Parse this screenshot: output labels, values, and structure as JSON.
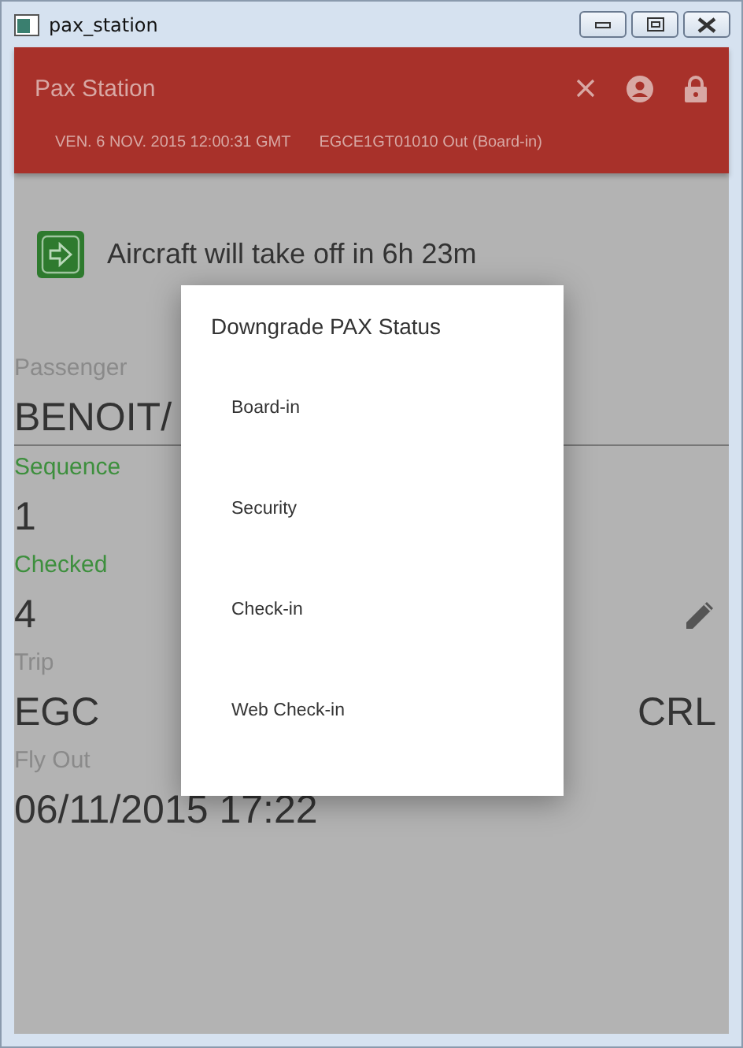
{
  "window": {
    "title": "pax_station"
  },
  "app_bar": {
    "title": "Pax Station",
    "date": "VEN. 6 NOV. 2015 12:00:31 GMT",
    "flight": "EGCE1GT01010 Out (Board-in)"
  },
  "notice": "Aircraft will take off in 6h 23m",
  "fields": [
    {
      "label": "Passenger",
      "value": "BENOIT/",
      "highlighted": false,
      "editable": false,
      "underline": true
    },
    {
      "label": "Sequence",
      "value": "1",
      "highlighted": true,
      "editable": false,
      "underline": false
    },
    {
      "label": "Checked",
      "value": "4",
      "highlighted": true,
      "editable": true,
      "underline": false
    }
  ],
  "trip": {
    "label": "Trip",
    "from": "EGC",
    "to": "CRL"
  },
  "fly_out": {
    "label": "Fly Out",
    "value": "06/11/2015 17:22"
  },
  "dialog": {
    "title": "Downgrade PAX Status",
    "options": [
      "Board-in",
      "Security",
      "Check-in",
      "Web Check-in"
    ]
  }
}
